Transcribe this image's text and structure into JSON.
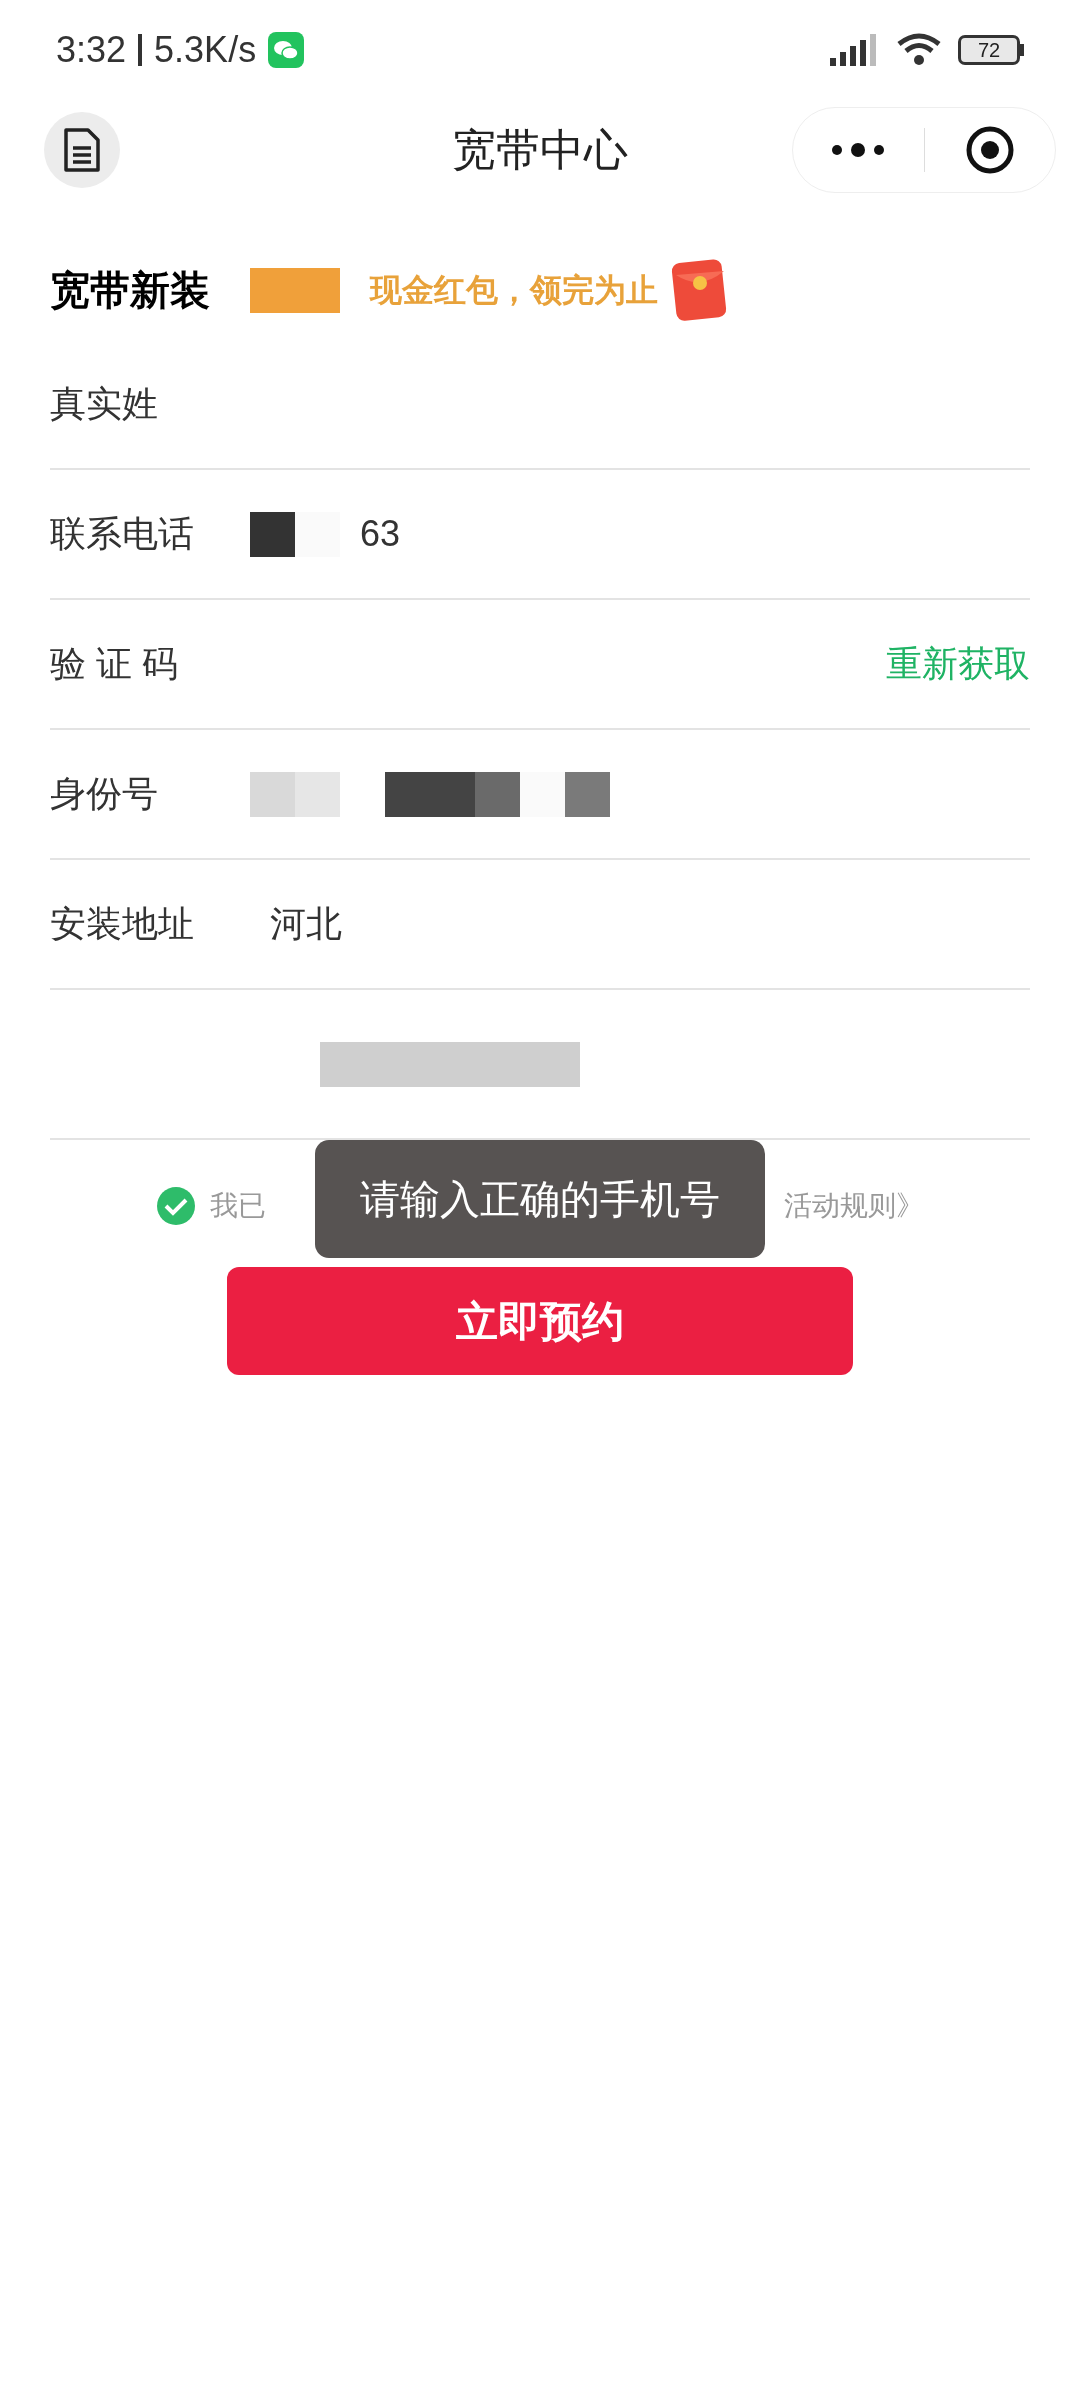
{
  "status_bar": {
    "time": "3:32",
    "speed": "5.3K/s",
    "battery": "72"
  },
  "nav": {
    "title": "宽带中心"
  },
  "promo": {
    "title": "宽带新装",
    "text": "现金红包，领完为止"
  },
  "fields": [
    {
      "kind": "text",
      "label": "真实姓"
    },
    {
      "kind": "text",
      "label": "联系电话",
      "value": "63"
    },
    {
      "kind": "code",
      "label": "验 证 码",
      "action": "重新获取"
    },
    {
      "kind": "text",
      "label": "身份号"
    },
    {
      "kind": "text",
      "label": "安装地址",
      "value": "河北"
    }
  ],
  "agreement": {
    "checked": true,
    "text_start": "我已",
    "text_end": "活动规则》"
  },
  "submit": "立即预约",
  "toast": "请输入正确的手机号"
}
